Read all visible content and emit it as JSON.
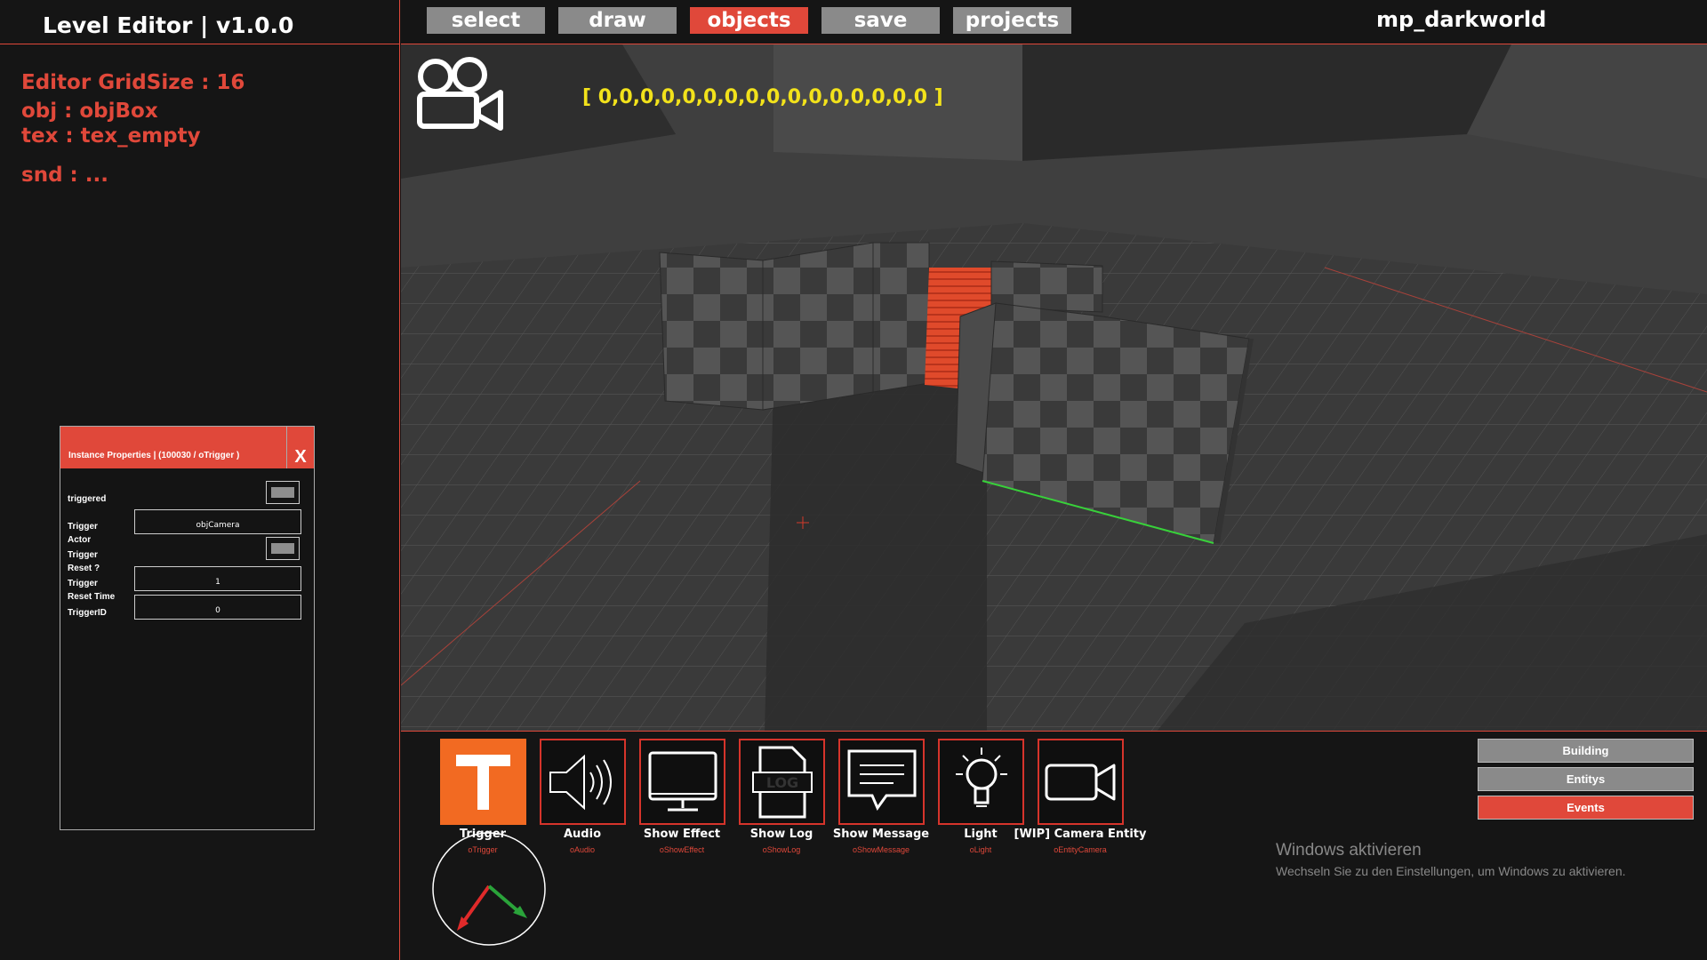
{
  "app": {
    "title": "Level Editor | v1.0.0",
    "map_name": "mp_darkworld"
  },
  "info": {
    "gridsize": "Editor GridSize : 16",
    "obj": "obj : objBox",
    "tex": "tex : tex_empty",
    "snd": "snd : ..."
  },
  "menu": [
    {
      "label": "select",
      "active": false
    },
    {
      "label": "draw",
      "active": false
    },
    {
      "label": "objects",
      "active": true
    },
    {
      "label": "save",
      "active": false
    },
    {
      "label": "projects",
      "active": false
    }
  ],
  "viewport": {
    "coords": "[ 0,0,0,0,0,0,0,0,0,0,0,0,0,0,0,0 ]"
  },
  "properties": {
    "title": "Instance Properties | (100030 / oTrigger )",
    "close": "X",
    "triggered_label": "triggered",
    "actor_label_1": "Trigger",
    "actor_label_2": "Actor",
    "actor_value": "objCamera",
    "reset_label_1": "Trigger",
    "reset_label_2": "Reset ?",
    "reset_time_label_1": "Trigger",
    "reset_time_label_2": "Reset Time",
    "reset_time_value": "1",
    "trigger_id_label": "TriggerID",
    "trigger_id_value": "0"
  },
  "entities": [
    {
      "name": "Trigger",
      "obj": "oTrigger",
      "icon": "trigger-icon"
    },
    {
      "name": "Audio",
      "obj": "oAudio",
      "icon": "speaker-icon"
    },
    {
      "name": "Show Effect",
      "obj": "oShowEffect",
      "icon": "monitor-icon"
    },
    {
      "name": "Show Log",
      "obj": "oShowLog",
      "icon": "log-icon"
    },
    {
      "name": "Show Message",
      "obj": "oShowMessage",
      "icon": "message-icon"
    },
    {
      "name": "Light",
      "obj": "oLight",
      "icon": "lightbulb-icon"
    },
    {
      "name": "[WIP] Camera Entity",
      "obj": "oEntityCamera",
      "icon": "camera-icon"
    }
  ],
  "categories": [
    {
      "label": "Building",
      "active": false
    },
    {
      "label": "Entitys",
      "active": false
    },
    {
      "label": "Events",
      "active": true
    }
  ],
  "windows": {
    "title": "Windows aktivieren",
    "subtitle": "Wechseln Sie zu den Einstellungen, um Windows zu aktivieren."
  },
  "colors": {
    "accent": "#e0483a",
    "coords": "#f2e21b",
    "trigger": "#f26a22"
  }
}
